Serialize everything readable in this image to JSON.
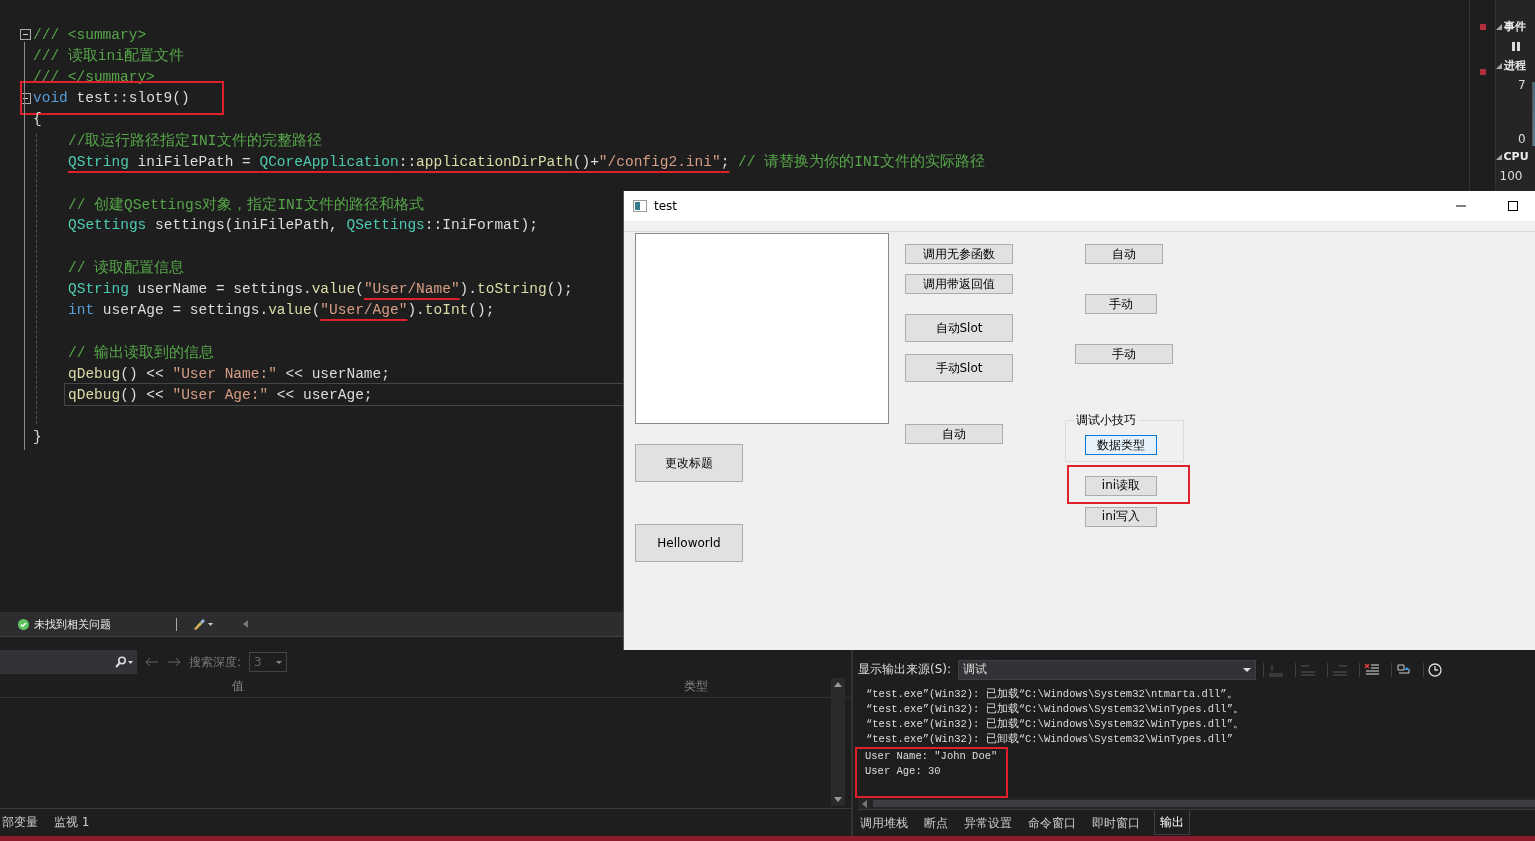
{
  "editor": {
    "lines": [
      {
        "kind": "code",
        "foldable": true,
        "tokens": [
          {
            "text": "/// <summary>",
            "kind": "comment"
          }
        ]
      },
      {
        "kind": "code",
        "tokens": [
          {
            "text": "/// 读取ini配置文件",
            "kind": "comment"
          }
        ]
      },
      {
        "kind": "code",
        "tokens": [
          {
            "text": "/// </summary>",
            "kind": "comment"
          }
        ]
      },
      {
        "kind": "code",
        "foldable": true,
        "boxed": true,
        "tokens": [
          {
            "text": "void",
            "kind": "keyword"
          },
          {
            "text": " test::slot9()",
            "kind": "plain"
          }
        ]
      },
      {
        "kind": "code",
        "tokens": [
          {
            "text": "{",
            "kind": "plain"
          }
        ],
        "children": [
          {
            "kind": "code",
            "tokens": [
              {
                "text": "//取运行路径指定INI文件的完整路径",
                "kind": "comment"
              }
            ]
          },
          {
            "kind": "code",
            "tokens": [
              {
                "text": "QString",
                "kind": "type",
                "underline": true
              },
              {
                "text": " iniFilePath = ",
                "kind": "plain",
                "underline": true
              },
              {
                "text": "QCoreApplication",
                "kind": "type",
                "underline": true
              },
              {
                "text": "::",
                "kind": "plain",
                "underline": true
              },
              {
                "text": "applicationDirPath",
                "kind": "function",
                "underline": true
              },
              {
                "text": "()+",
                "kind": "plain",
                "underline": true
              },
              {
                "text": "\"/config2.ini\"",
                "kind": "string",
                "underline": true
              },
              {
                "text": ";",
                "kind": "plain",
                "underline": true
              },
              {
                "text": " // 请替换为你的INI文件的实际路径",
                "kind": "comment"
              }
            ]
          },
          {
            "kind": "blank"
          },
          {
            "kind": "code",
            "tokens": [
              {
                "text": "// 创建QSettings对象，指定INI文件的路径和格式",
                "kind": "comment"
              }
            ]
          },
          {
            "kind": "code",
            "tokens": [
              {
                "text": "QSettings",
                "kind": "type"
              },
              {
                "text": " settings(iniFilePath, ",
                "kind": "plain"
              },
              {
                "text": "QSettings",
                "kind": "type"
              },
              {
                "text": "::IniFormat);",
                "kind": "plain"
              }
            ]
          },
          {
            "kind": "blank"
          },
          {
            "kind": "code",
            "tokens": [
              {
                "text": "// 读取配置信息",
                "kind": "comment"
              }
            ]
          },
          {
            "kind": "code",
            "tokens": [
              {
                "text": "QString",
                "kind": "type"
              },
              {
                "text": " userName = settings.",
                "kind": "plain"
              },
              {
                "text": "value",
                "kind": "function"
              },
              {
                "text": "(",
                "kind": "plain"
              },
              {
                "text": "\"User/Name\"",
                "kind": "string",
                "underline": true
              },
              {
                "text": ").",
                "kind": "plain"
              },
              {
                "text": "toString",
                "kind": "function"
              },
              {
                "text": "();",
                "kind": "plain"
              }
            ]
          },
          {
            "kind": "code",
            "tokens": [
              {
                "text": "int",
                "kind": "keyword"
              },
              {
                "text": " userAge = settings.",
                "kind": "plain"
              },
              {
                "text": "value",
                "kind": "function"
              },
              {
                "text": "(",
                "kind": "plain"
              },
              {
                "text": "\"User/Age\"",
                "kind": "string",
                "underline": true
              },
              {
                "text": ").",
                "kind": "plain"
              },
              {
                "text": "toInt",
                "kind": "function"
              },
              {
                "text": "();",
                "kind": "plain"
              }
            ]
          },
          {
            "kind": "blank"
          },
          {
            "kind": "code",
            "tokens": [
              {
                "text": "// 输出读取到的信息",
                "kind": "comment"
              }
            ]
          },
          {
            "kind": "code",
            "tokens": [
              {
                "text": "qDebug",
                "kind": "function"
              },
              {
                "text": "() << ",
                "kind": "plain"
              },
              {
                "text": "\"User Name:\"",
                "kind": "string"
              },
              {
                "text": " << userName;",
                "kind": "plain"
              }
            ]
          },
          {
            "kind": "code",
            "current": true,
            "tokens": [
              {
                "text": "qDebug",
                "kind": "function"
              },
              {
                "text": "() << ",
                "kind": "plain"
              },
              {
                "text": "\"User Age:\"",
                "kind": "string"
              },
              {
                "text": " << userAge;",
                "kind": "plain"
              }
            ]
          },
          {
            "kind": "blank"
          }
        ]
      },
      {
        "kind": "code",
        "tokens": [
          {
            "text": "}",
            "kind": "plain"
          }
        ]
      }
    ]
  },
  "diagnostics": {
    "sections": [
      {
        "title": "事件",
        "expanded": true
      },
      {
        "title": "进程",
        "expanded": true
      },
      {
        "title": "CPU",
        "expanded": true
      }
    ],
    "memory_max": "7",
    "memory_min": "0",
    "cpu_max": "100"
  },
  "status_bar": {
    "issues": "未找到相关问题"
  },
  "locals_panel": {
    "search_depth_label": "搜索深度:",
    "search_depth": "3",
    "columns": [
      "值",
      "类型"
    ],
    "tabs": [
      {
        "label": "部变量",
        "selected": false
      },
      {
        "label": "监视 1",
        "selected": false
      }
    ]
  },
  "output_panel": {
    "source_label": "显示输出来源(S):",
    "source": "调试",
    "lines": [
      {
        "text": "“test.exe”(Win32): 已加载“C:\\Windows\\System32\\ntmarta.dll”。",
        "highlighted": false
      },
      {
        "text": "“test.exe”(Win32): 已加载“C:\\Windows\\System32\\WinTypes.dll”。",
        "highlighted": false
      },
      {
        "text": "“test.exe”(Win32): 已加载“C:\\Windows\\System32\\WinTypes.dll”。",
        "highlighted": false
      },
      {
        "text": "“test.exe”(Win32): 已卸载“C:\\Windows\\System32\\WinTypes.dll”",
        "highlighted": false
      },
      {
        "text": "User Name: \"John Doe\"",
        "highlighted": true
      },
      {
        "text": "User Age: 30",
        "highlighted": true
      }
    ],
    "tabs": [
      {
        "label": "调用堆栈",
        "selected": false
      },
      {
        "label": "断点",
        "selected": false
      },
      {
        "label": "异常设置",
        "selected": false
      },
      {
        "label": "命令窗口",
        "selected": false
      },
      {
        "label": "即时窗口",
        "selected": false
      },
      {
        "label": "输出",
        "selected": true
      }
    ]
  },
  "test_window": {
    "title": "test",
    "columns": [
      {
        "items": [
          {
            "kind": "button",
            "label": "更改标题"
          },
          {
            "kind": "button",
            "label": "Helloworld"
          }
        ]
      },
      {
        "items": [
          {
            "kind": "button",
            "label": "调用无参函数"
          },
          {
            "kind": "button",
            "label": "调用带返回值"
          },
          {
            "kind": "button",
            "label": "自动Slot"
          },
          {
            "kind": "button",
            "label": "手动Slot"
          },
          {
            "kind": "button",
            "label": "自动"
          }
        ]
      },
      {
        "items": [
          {
            "kind": "button",
            "label": "自动"
          },
          {
            "kind": "button",
            "label": "手动"
          },
          {
            "kind": "button",
            "label": "手动"
          },
          {
            "kind": "group",
            "title": "调试小技巧",
            "buttons": [
              {
                "label": "数据类型",
                "focused": true
              }
            ]
          },
          {
            "kind": "button",
            "label": "ini读取",
            "highlighted": true
          },
          {
            "kind": "button",
            "label": "ini写入"
          }
        ]
      }
    ]
  }
}
